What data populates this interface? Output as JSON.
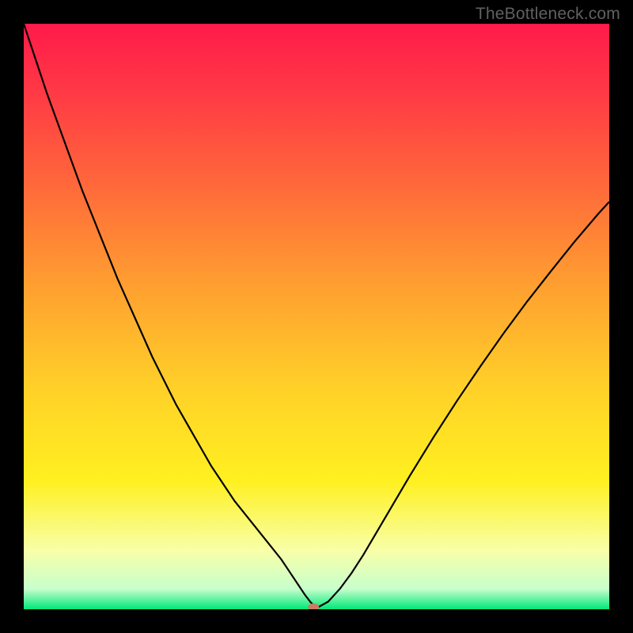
{
  "watermark": "TheBottleneck.com",
  "chart_data": {
    "type": "line",
    "title": "",
    "xlabel": "",
    "ylabel": "",
    "xlim": [
      0,
      100
    ],
    "ylim": [
      0,
      100
    ],
    "background_gradient": {
      "stops": [
        {
          "offset": 0.0,
          "color": "#ff1a4a"
        },
        {
          "offset": 0.12,
          "color": "#ff3a45"
        },
        {
          "offset": 0.28,
          "color": "#ff6a3a"
        },
        {
          "offset": 0.45,
          "color": "#ffa030"
        },
        {
          "offset": 0.62,
          "color": "#ffd028"
        },
        {
          "offset": 0.78,
          "color": "#fff020"
        },
        {
          "offset": 0.9,
          "color": "#f8ffa8"
        },
        {
          "offset": 0.965,
          "color": "#c8ffcc"
        },
        {
          "offset": 1.0,
          "color": "#00e878"
        }
      ]
    },
    "series": [
      {
        "name": "bottleneck-curve",
        "color": "#000000",
        "x": [
          0,
          2,
          4,
          6,
          8,
          10,
          12,
          14,
          16,
          18,
          20,
          22,
          24,
          26,
          28,
          30,
          32,
          34,
          36,
          38,
          40,
          42,
          44,
          45,
          46,
          47,
          48,
          49,
          50,
          52,
          54,
          56,
          58,
          60,
          63,
          66,
          70,
          74,
          78,
          82,
          86,
          90,
          94,
          98,
          100
        ],
        "y": [
          100,
          94,
          88,
          82.5,
          77,
          71.5,
          66.5,
          61.5,
          56.5,
          52,
          47.5,
          43,
          39,
          35,
          31.5,
          28,
          24.5,
          21.5,
          18.5,
          16,
          13.5,
          11,
          8.5,
          7,
          5.5,
          4,
          2.5,
          1.2,
          0.2,
          1.3,
          3.5,
          6.2,
          9.3,
          12.7,
          17.8,
          22.9,
          29.4,
          35.6,
          41.5,
          47.2,
          52.6,
          57.7,
          62.7,
          67.4,
          69.6
        ]
      }
    ],
    "marker": {
      "name": "optimum-marker",
      "x": 49.5,
      "y": 0,
      "color": "#cc7a66",
      "rx": 7,
      "ry": 4.5
    }
  }
}
